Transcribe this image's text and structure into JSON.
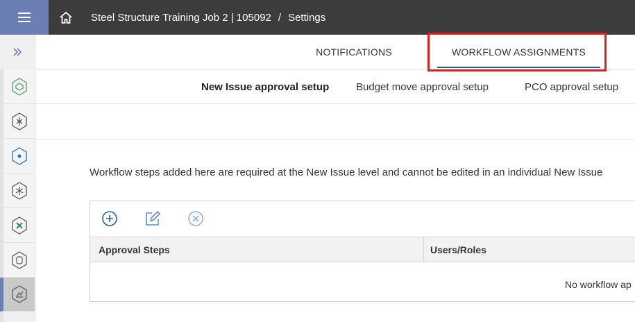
{
  "header": {
    "menu_icon": "hamburger-icon",
    "home_icon": "home-icon",
    "project": "Steel Structure Training Job 2 | 105092",
    "separator": "/",
    "page": "Settings",
    "accent_color": "#6b7fb4",
    "bar_color": "#3c3c3c"
  },
  "rail": {
    "expand_icon": "double-chevron-right-icon",
    "items": [
      {
        "icon": "hexagon-outline-icon"
      },
      {
        "icon": "hexagon-network-icon"
      },
      {
        "icon": "hexagon-target-icon"
      },
      {
        "icon": "hexagon-spark-icon"
      },
      {
        "icon": "hexagon-tools-icon"
      },
      {
        "icon": "hexagon-document-icon"
      },
      {
        "icon": "hexagon-chart-icon",
        "active": true
      }
    ]
  },
  "tabs": {
    "notifications": "NOTIFICATIONS",
    "workflow": "WORKFLOW ASSIGNMENTS",
    "active": "workflow",
    "highlight_color": "#e21c1c"
  },
  "subtabs": {
    "new_issue": "New Issue approval setup",
    "budget_move": "Budget move approval setup",
    "pco": "PCO approval setup"
  },
  "info": "Workflow steps added here are required at the New Issue level and cannot be edited in an individual New Issue",
  "toolbar": {
    "add_icon": "add-circle-icon",
    "edit_icon": "edit-icon",
    "remove_icon": "remove-circle-icon"
  },
  "table": {
    "columns": [
      "Approval Steps",
      "Users/Roles"
    ],
    "empty_message": "No workflow ap"
  }
}
